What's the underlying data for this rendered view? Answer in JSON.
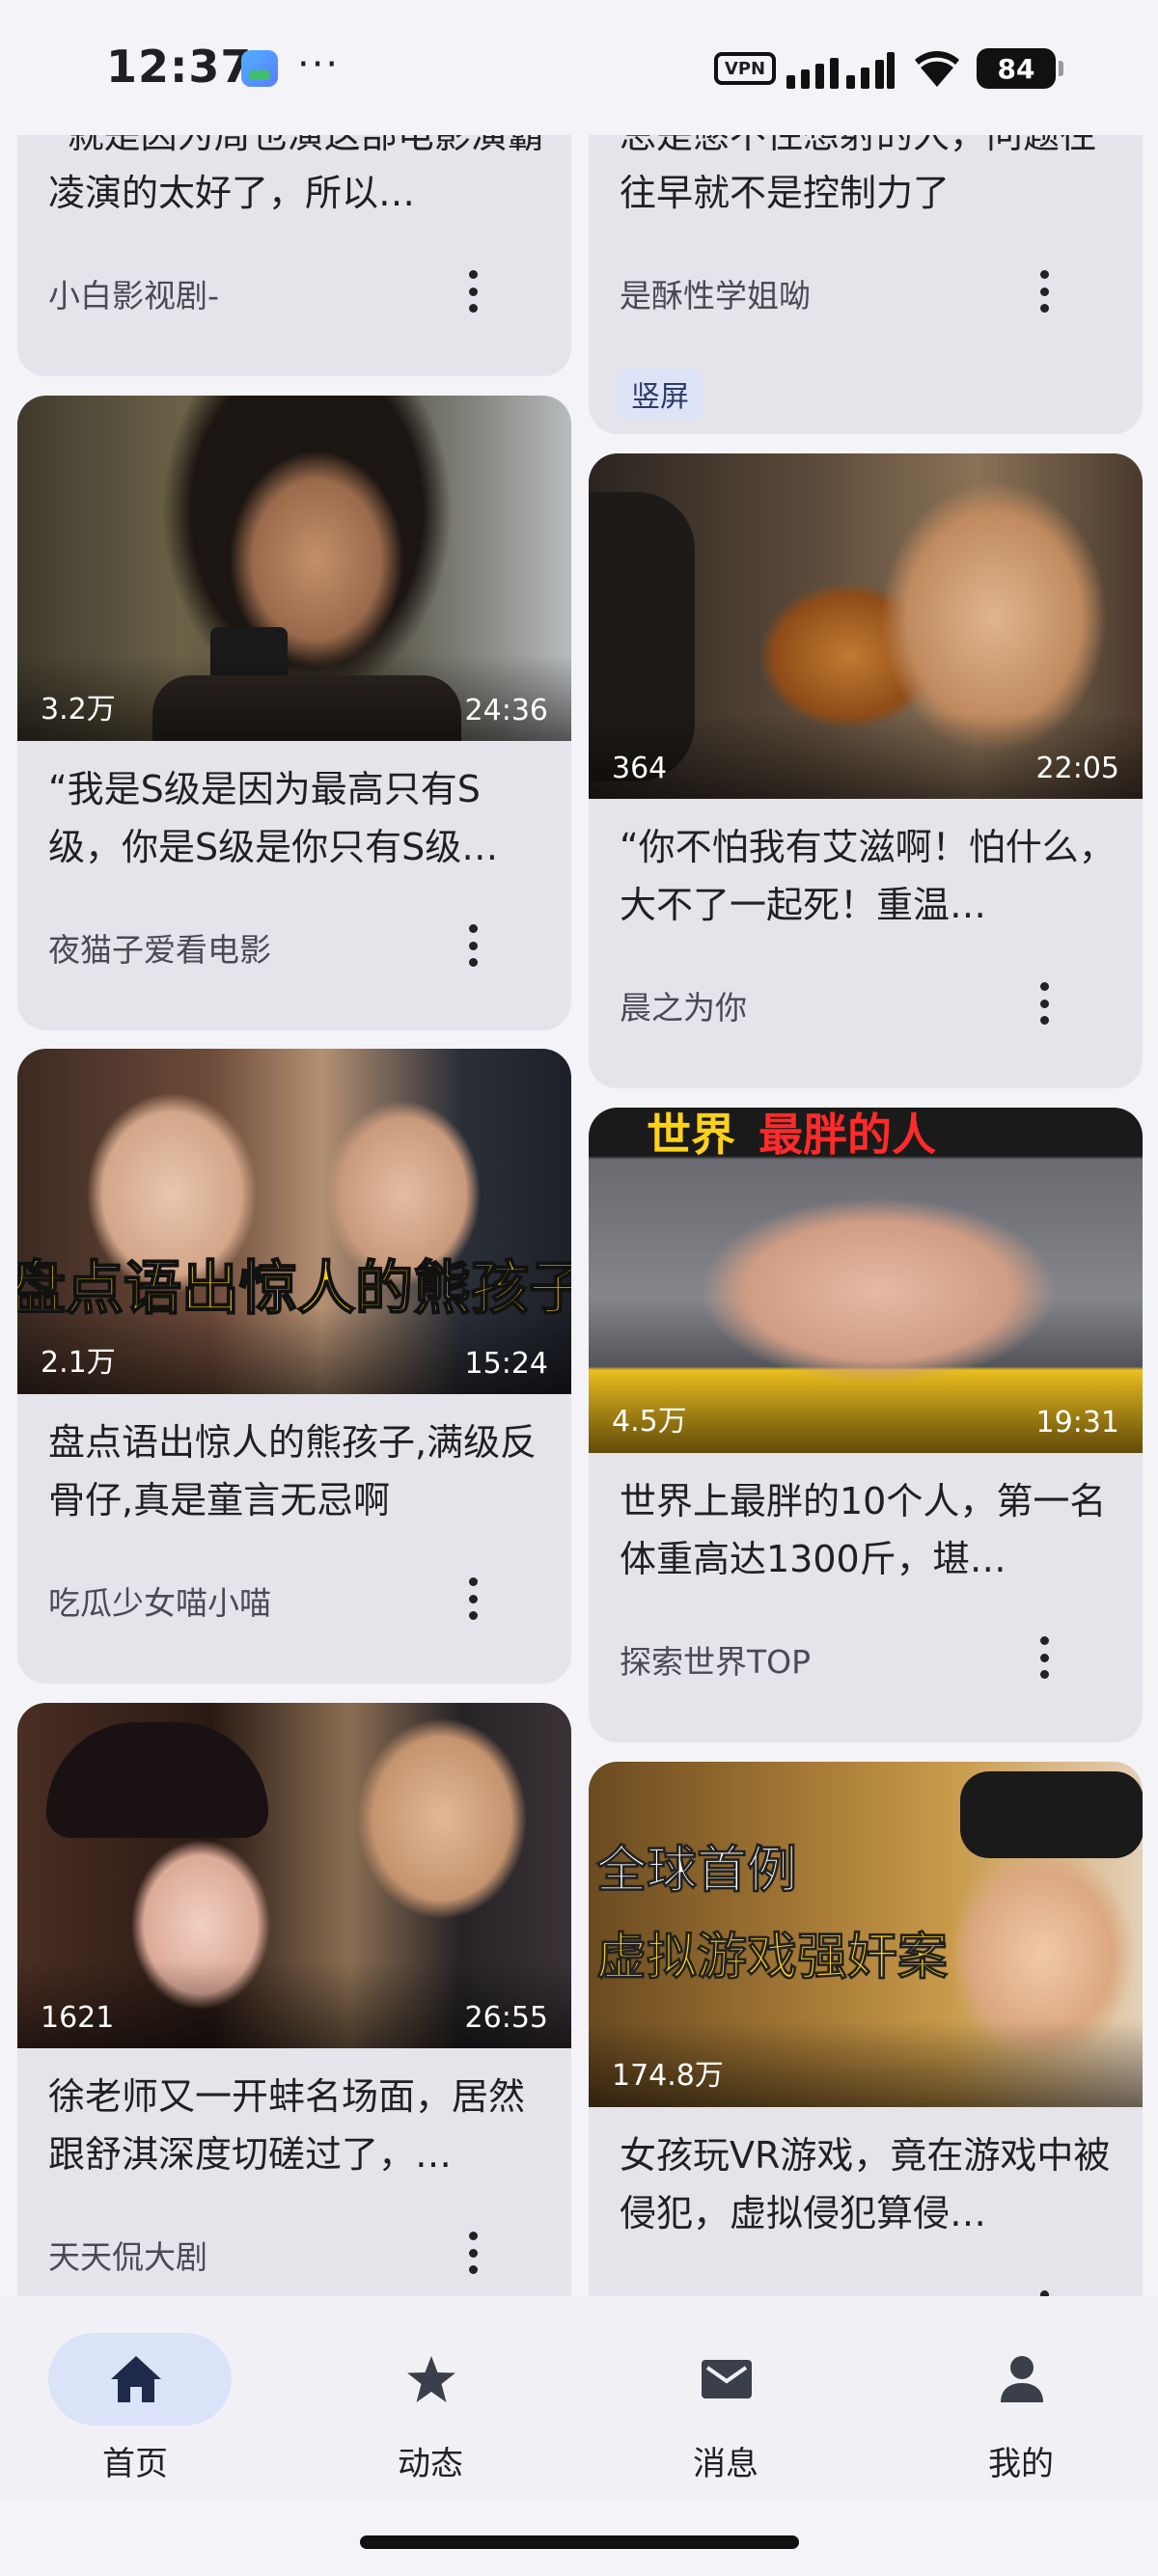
{
  "status_bar": {
    "time": "12:37",
    "more": "···",
    "vpn": "VPN",
    "battery": "84"
  },
  "feed": {
    "cards": [
      {
        "title": "“就是因为周也演这部电影演霸凌演的太好了，所以…",
        "author": "小白影视剧-"
      },
      {
        "title": "总是憋不住想射的人，问题往往早就不是控制力了",
        "author": "是酥性学姐呦",
        "tag": "竖屏"
      },
      {
        "title": "“我是S级是因为最高只有S级，你是S级是你只有S级…",
        "author": "夜猫子爱看电影",
        "views": "3.2万",
        "duration": "24:36"
      },
      {
        "title": "“你不怕我有艾滋啊！怕什么，大不了一起死！重温…",
        "author": "晨之为你",
        "views": "364",
        "duration": "22:05"
      },
      {
        "title": "盘点语出惊人的熊孩子,满级反骨仔,真是童言无忌啊",
        "author": "吃瓜少女喵小喵",
        "views": "2.1万",
        "duration": "15:24",
        "overlay": "盘点语出惊人的熊孩子"
      },
      {
        "title": "世界上最胖的10个人，第一名体重高达1300斤，堪…",
        "author": "探索世界TOP",
        "views": "4.5万",
        "duration": "19:31",
        "overlay_a": "世界",
        "overlay_b": "最胖的人"
      },
      {
        "title": "徐老师又一开蚌名场面，居然跟舒淇深度切磋过了，…",
        "author": "天天侃大剧",
        "views": "1621",
        "duration": "26:55"
      },
      {
        "title": "女孩玩VR游戏，竟在游戏中被侵犯，虚拟侵犯算侵…",
        "author": "",
        "views": "174.8万",
        "overlay_a": "全球首例",
        "overlay_b": "虚拟游戏强奸案"
      }
    ]
  },
  "nav": {
    "items": [
      {
        "label": "首页",
        "icon": "home-icon",
        "active": true
      },
      {
        "label": "动态",
        "icon": "star-icon"
      },
      {
        "label": "消息",
        "icon": "mail-icon"
      },
      {
        "label": "我的",
        "icon": "person-icon"
      }
    ]
  },
  "colors": {
    "background": "#f4f3f8",
    "card": "#e5e4ea",
    "nav_active_pill": "#dbe3f9",
    "tag_bg": "#dde4f8"
  }
}
